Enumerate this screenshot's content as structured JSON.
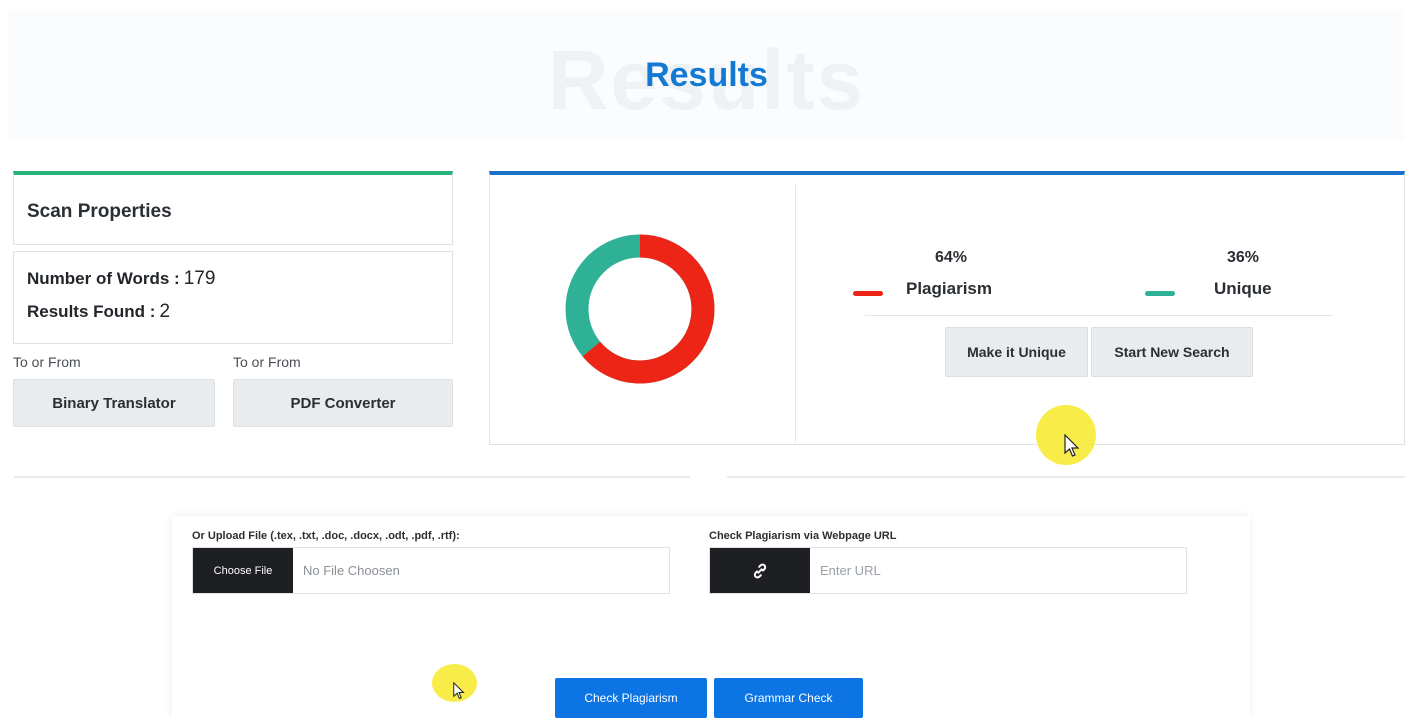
{
  "header": {
    "title": "Results",
    "watermark": "Results"
  },
  "scan": {
    "heading": "Scan Properties",
    "words_label": "Number of Words :",
    "words_value": "179",
    "results_label": "Results Found :",
    "results_value": "2"
  },
  "tools": [
    {
      "caption": "To or From",
      "label": "Binary Translator"
    },
    {
      "caption": "To or From",
      "label": "PDF Converter"
    }
  ],
  "result": {
    "plagiarism": {
      "percent": "64%",
      "label": "Plagiarism",
      "color": "#ec2517",
      "value": 64
    },
    "unique": {
      "percent": "36%",
      "label": "Unique",
      "color": "#2fb196",
      "value": 36
    },
    "buttons": {
      "make_unique": "Make it Unique",
      "new_search": "Start New Search"
    }
  },
  "upload": {
    "file_label": "Or Upload File (.tex, .txt, .doc, .docx, .odt, .pdf, .rtf):",
    "choose_label": "Choose File",
    "file_status": "No File Choosen",
    "url_label": "Check Plagiarism via Webpage URL",
    "url_placeholder": "Enter URL",
    "link_icon": "link-icon"
  },
  "actions": {
    "check": "Check Plagiarism",
    "grammar": "Grammar Check"
  },
  "colors": {
    "accent_blue": "#1479d2",
    "button_blue": "#0d74e3",
    "green_bar": "#27b37a"
  }
}
